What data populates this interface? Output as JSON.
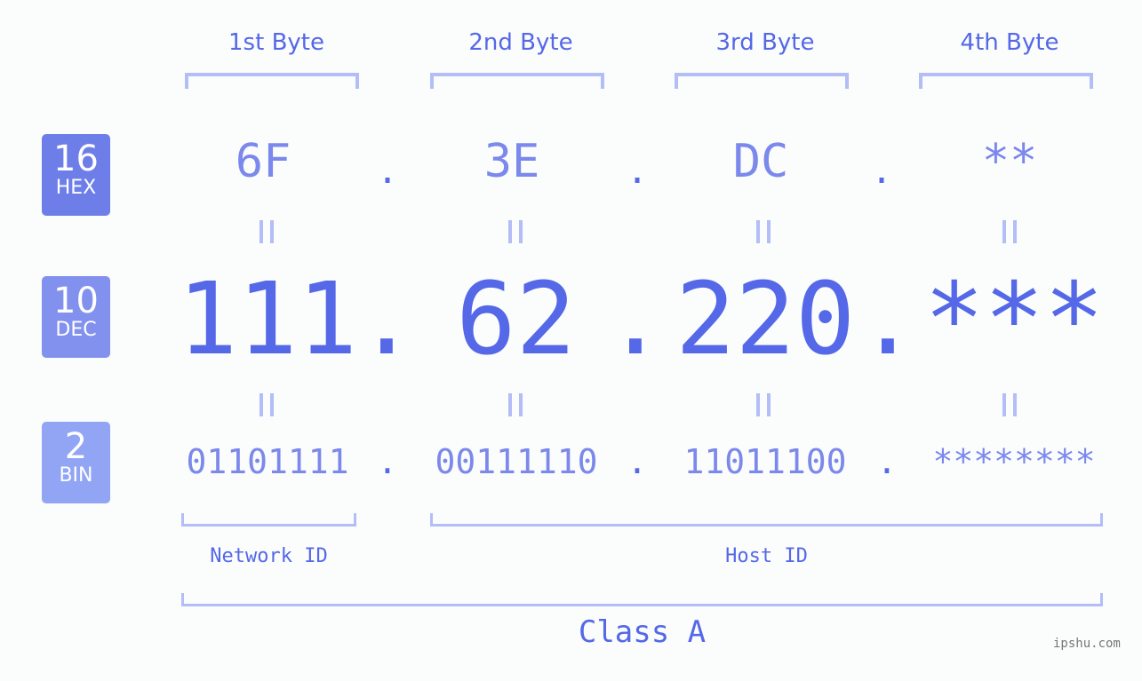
{
  "headers": [
    "1st Byte",
    "2nd Byte",
    "3rd Byte",
    "4th Byte"
  ],
  "badges": {
    "hex": {
      "num": "16",
      "label": "HEX",
      "color": "#6e7ee9"
    },
    "dec": {
      "num": "10",
      "label": "DEC",
      "color": "#8391ee"
    },
    "bin": {
      "num": "2",
      "label": "BIN",
      "color": "#91a5f4"
    }
  },
  "hex_values": [
    "6F",
    "3E",
    "DC",
    "**"
  ],
  "dec_values": [
    "111",
    "62",
    "220",
    "***"
  ],
  "bin_values": [
    "01101111",
    "00111110",
    "11011100",
    "********"
  ],
  "separator": ".",
  "network_label": "Network ID",
  "host_label": "Host ID",
  "class_label": "Class A",
  "watermark": "ipshu.com",
  "colors": {
    "accent": "#5468e8",
    "light": "#7b88ec",
    "bracket": "#b3bdf6"
  }
}
